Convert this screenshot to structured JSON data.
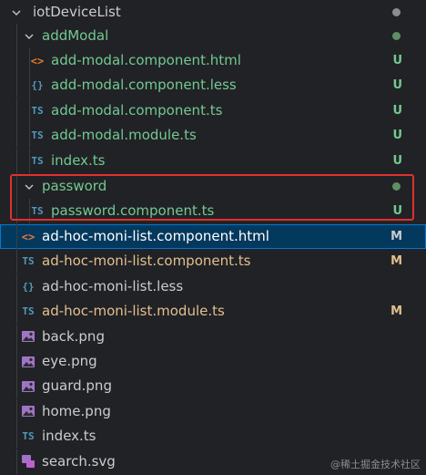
{
  "colors": {
    "untracked": "#73c991",
    "modified": "#e2c08d",
    "plain": "#cccccc",
    "ts_icon": "#519aba",
    "html_icon": "#e37933",
    "less_icon": "#519aba",
    "image_icon": "#a074c4",
    "svg_icon": "#a074c4",
    "dot_folder": "#6f8a6f",
    "highlight_border": "#e0302f",
    "selected_bg": "#04395e"
  },
  "tree": {
    "root": {
      "label": "iotDeviceList",
      "icon": "chevron-down-icon"
    },
    "addModal": {
      "label": "addModal",
      "icon": "chevron-down-icon"
    },
    "files_add": [
      {
        "label": "add-modal.component.html",
        "icon": "html-file-icon",
        "glyph": "<>",
        "status": "U"
      },
      {
        "label": "add-modal.component.less",
        "icon": "less-file-icon",
        "glyph": "{}",
        "status": "U"
      },
      {
        "label": "add-modal.component.ts",
        "icon": "ts-file-icon",
        "glyph": "TS",
        "status": "U"
      },
      {
        "label": "add-modal.module.ts",
        "icon": "ts-file-icon",
        "glyph": "TS",
        "status": "U"
      },
      {
        "label": "index.ts",
        "icon": "ts-file-icon",
        "glyph": "TS",
        "status": "U"
      }
    ],
    "password": {
      "label": "password",
      "icon": "chevron-down-icon"
    },
    "files_password": [
      {
        "label": "password.component.ts",
        "icon": "ts-file-icon",
        "glyph": "TS",
        "status": "U"
      }
    ],
    "files_root": [
      {
        "label": "ad-hoc-moni-list.component.html",
        "icon": "html-file-icon",
        "glyph": "<>",
        "status": "M"
      },
      {
        "label": "ad-hoc-moni-list.component.ts",
        "icon": "ts-file-icon",
        "glyph": "TS",
        "status": "M"
      },
      {
        "label": "ad-hoc-moni-list.less",
        "icon": "less-file-icon",
        "glyph": "{}",
        "status": ""
      },
      {
        "label": "ad-hoc-moni-list.module.ts",
        "icon": "ts-file-icon",
        "glyph": "TS",
        "status": "M"
      },
      {
        "label": "back.png",
        "icon": "image-file-icon",
        "glyph": "",
        "status": ""
      },
      {
        "label": "eye.png",
        "icon": "image-file-icon",
        "glyph": "",
        "status": ""
      },
      {
        "label": "guard.png",
        "icon": "image-file-icon",
        "glyph": "",
        "status": ""
      },
      {
        "label": "home.png",
        "icon": "image-file-icon",
        "glyph": "",
        "status": ""
      },
      {
        "label": "index.ts",
        "icon": "ts-file-icon",
        "glyph": "TS",
        "status": ""
      },
      {
        "label": "search.svg",
        "icon": "svg-file-icon",
        "glyph": "",
        "status": ""
      }
    ]
  },
  "watermark": "@稀土掘金技术社区"
}
